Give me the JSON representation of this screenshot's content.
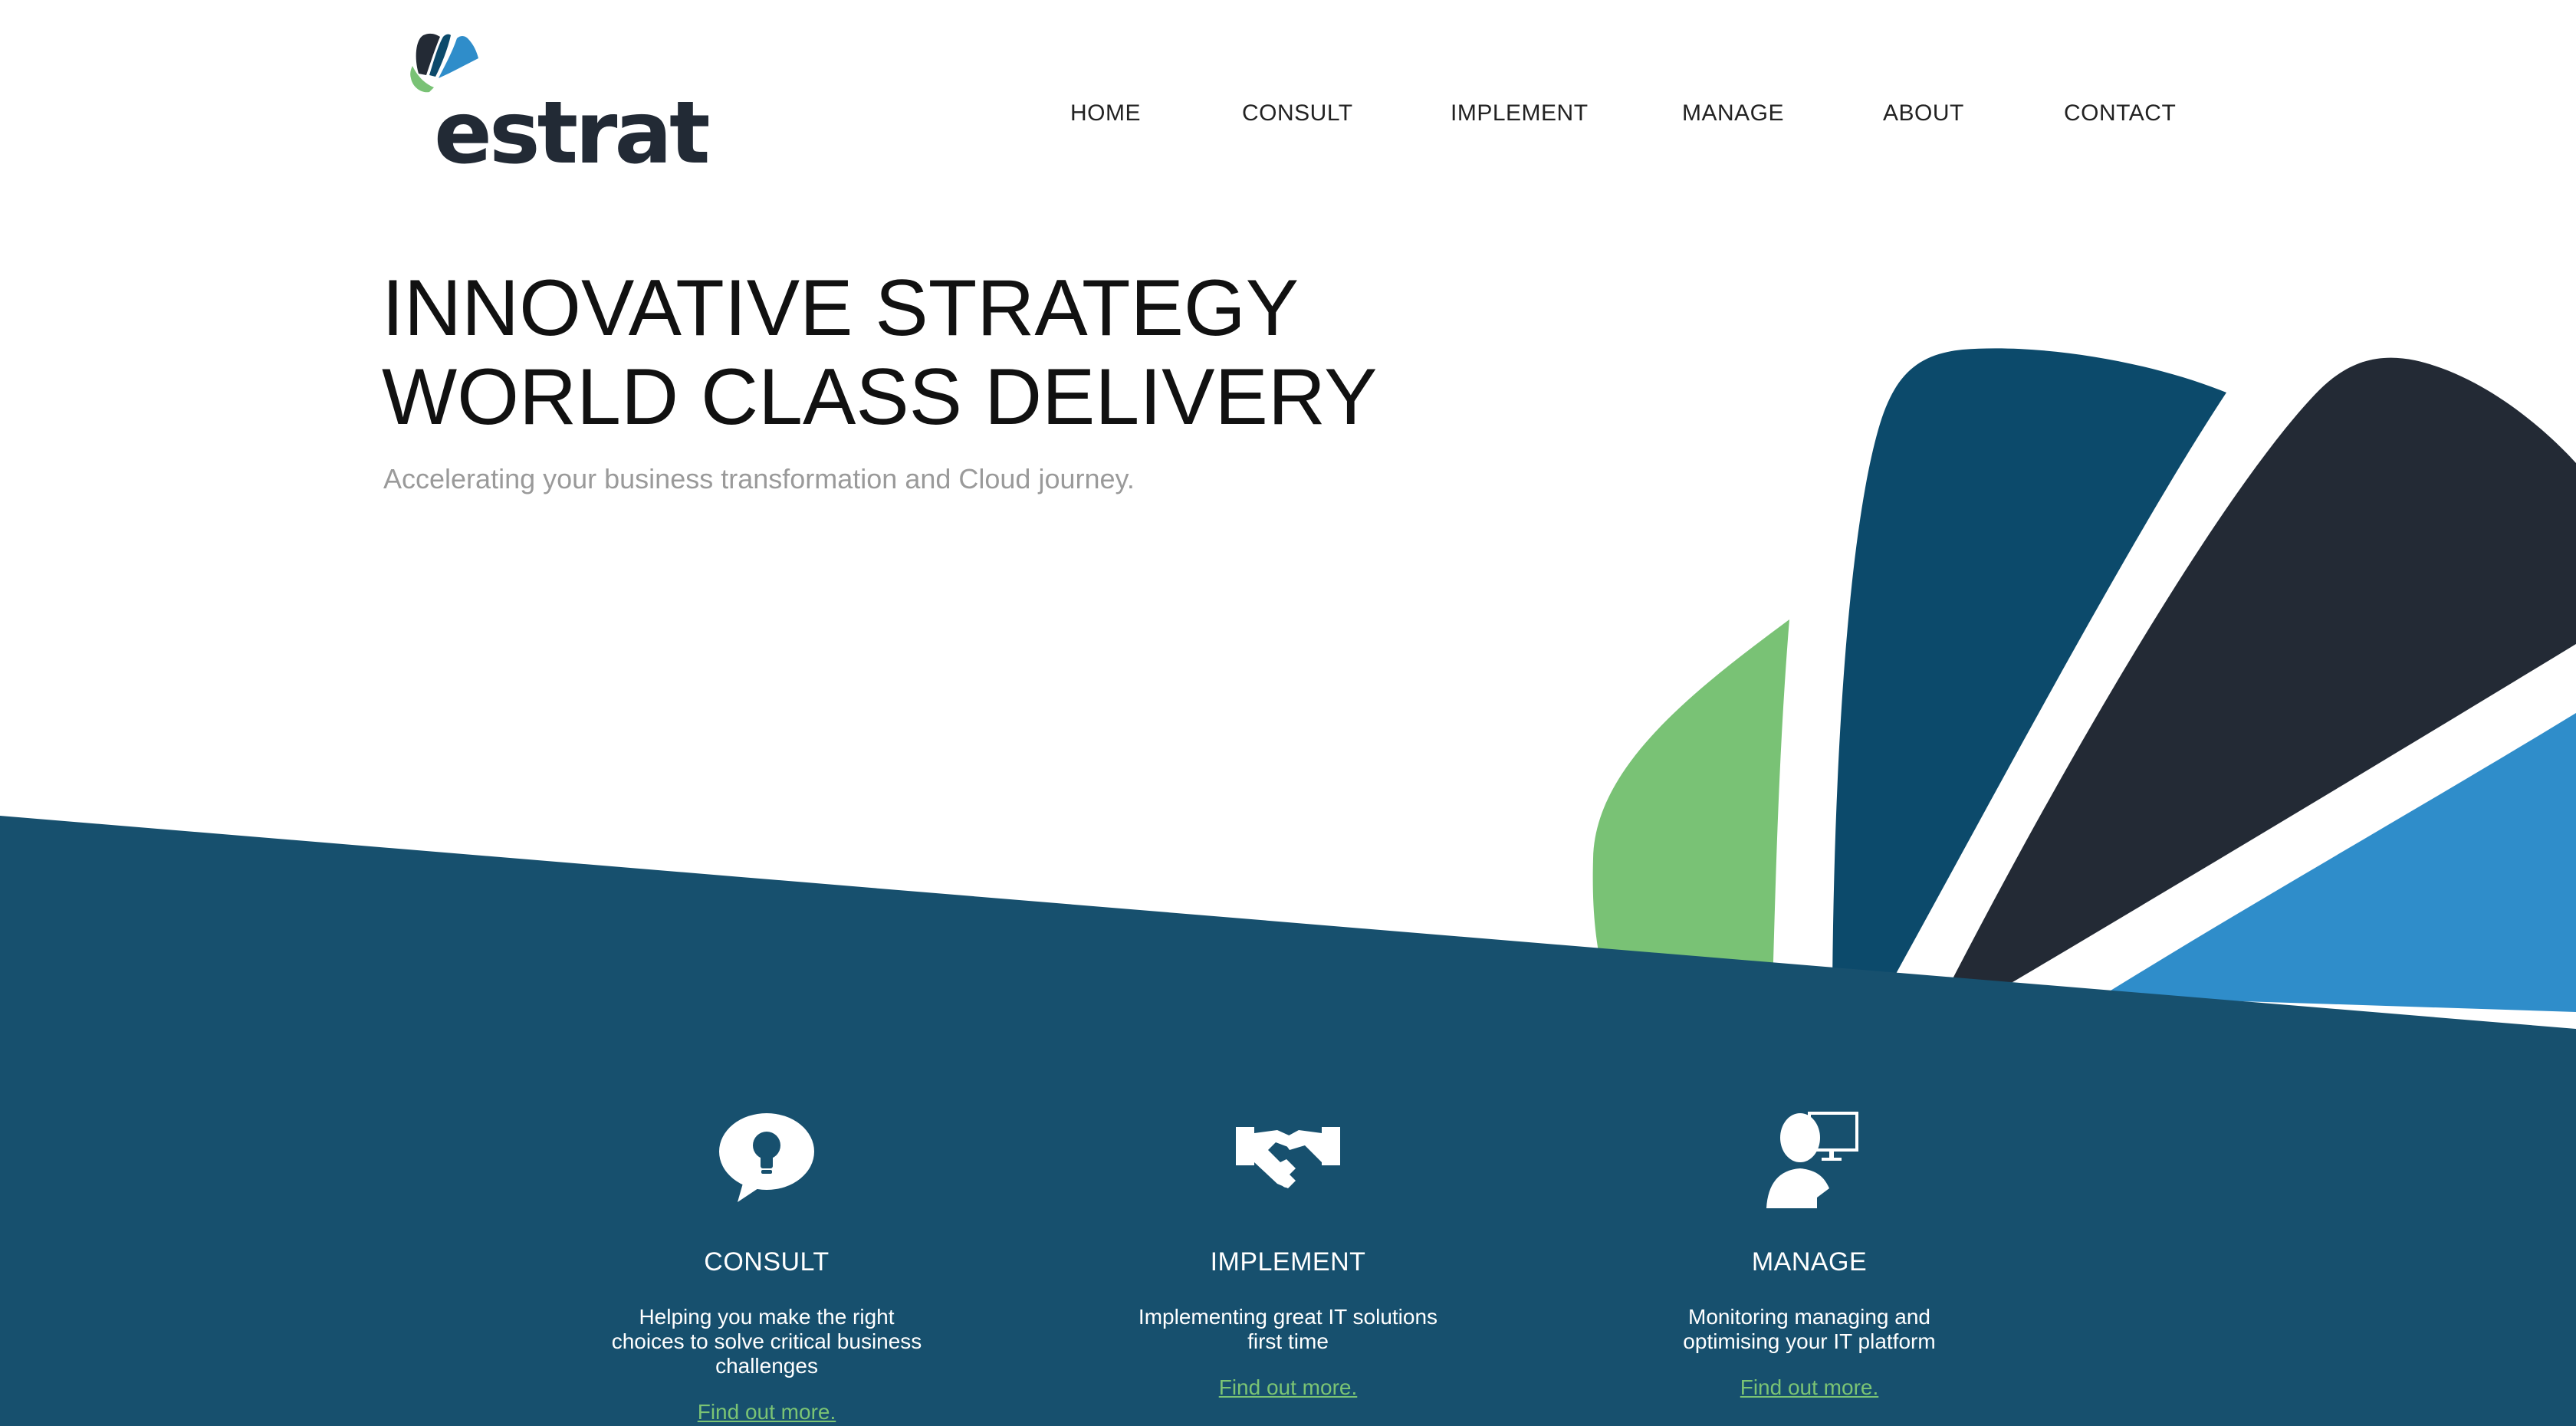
{
  "brand": {
    "name": "estrat",
    "colors": {
      "navy": "#17506e",
      "dark_blue": "#0c4a6b",
      "charcoal": "#232a35",
      "light_blue": "#2f8dca",
      "green": "#79c275",
      "link_green": "#7bc474"
    }
  },
  "nav": {
    "items": [
      {
        "label": "HOME"
      },
      {
        "label": "CONSULT"
      },
      {
        "label": "IMPLEMENT"
      },
      {
        "label": "MANAGE"
      },
      {
        "label": "ABOUT"
      },
      {
        "label": "CONTACT"
      }
    ]
  },
  "hero": {
    "title_line1": "INNOVATIVE STRATEGY",
    "title_line2": "WORLD CLASS DELIVERY",
    "subtitle": "Accelerating your business transformation and Cloud journey."
  },
  "services": [
    {
      "icon": "lightbulb-speech-bubble-icon",
      "title": "CONSULT",
      "description": "Helping you make the right choices to solve critical business challenges",
      "link": "Find out more."
    },
    {
      "icon": "handshake-icon",
      "title": "IMPLEMENT",
      "description": "Implementing great IT solutions first time",
      "link": "Find out more."
    },
    {
      "icon": "person-monitor-icon",
      "title": "MANAGE",
      "description": "Monitoring managing and optimising your IT platform",
      "link": "Find out more."
    }
  ]
}
